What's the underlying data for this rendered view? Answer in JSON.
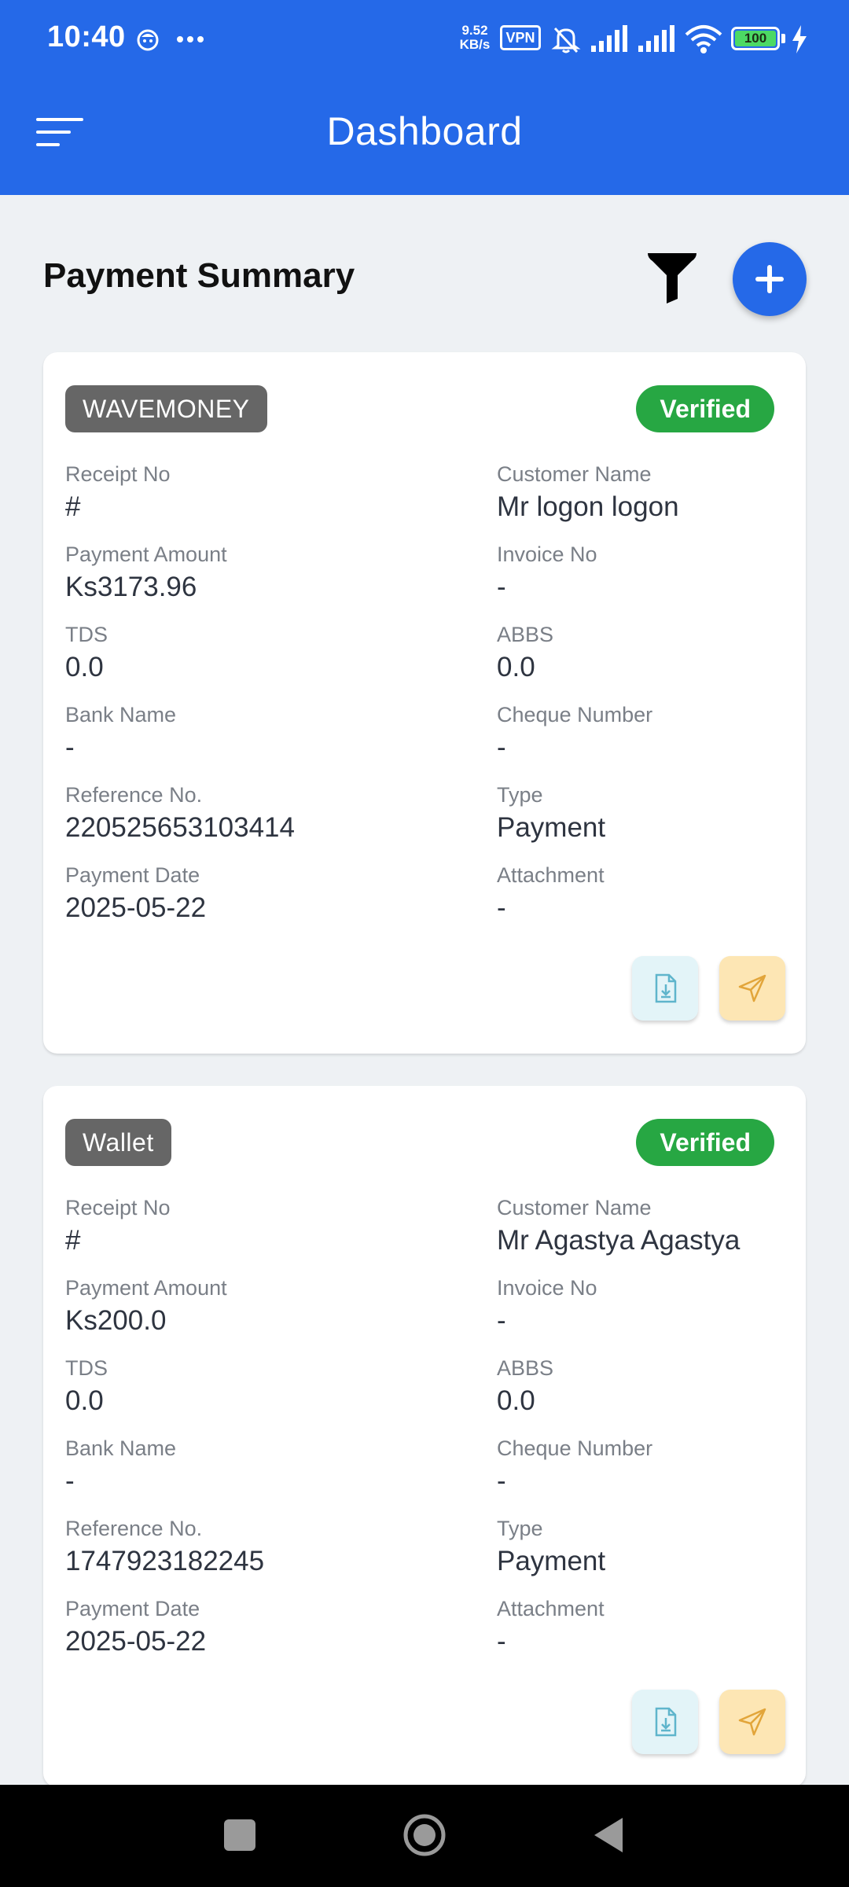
{
  "status_bar": {
    "time": "10:40",
    "net_speed_value": "9.52",
    "net_speed_unit": "KB/s",
    "vpn": "VPN",
    "battery": "100"
  },
  "app_bar": {
    "title": "Dashboard"
  },
  "summary": {
    "title": "Payment Summary"
  },
  "colors": {
    "primary": "#2569e8",
    "verified": "#27a743",
    "method_badge": "#666666"
  },
  "payments": [
    {
      "method": "WAVEMONEY",
      "status": "Verified",
      "fields": {
        "receipt_no": {
          "label": "Receipt No",
          "value": "#"
        },
        "customer_name": {
          "label": "Customer Name",
          "value": "Mr logon logon"
        },
        "payment_amount": {
          "label": "Payment Amount",
          "value": "Ks3173.96"
        },
        "invoice_no": {
          "label": "Invoice No",
          "value": "-"
        },
        "tds": {
          "label": "TDS",
          "value": "0.0"
        },
        "abbs": {
          "label": "ABBS",
          "value": "0.0"
        },
        "bank_name": {
          "label": "Bank Name",
          "value": "-"
        },
        "cheque_number": {
          "label": "Cheque Number",
          "value": "-"
        },
        "reference_no": {
          "label": "Reference No.",
          "value": "220525653103414"
        },
        "type": {
          "label": "Type",
          "value": "Payment"
        },
        "payment_date": {
          "label": "Payment Date",
          "value": "2025-05-22"
        },
        "attachment": {
          "label": "Attachment",
          "value": "-"
        }
      }
    },
    {
      "method": "Wallet",
      "status": "Verified",
      "fields": {
        "receipt_no": {
          "label": "Receipt No",
          "value": "#"
        },
        "customer_name": {
          "label": "Customer Name",
          "value": "Mr Agastya Agastya"
        },
        "payment_amount": {
          "label": "Payment Amount",
          "value": "Ks200.0"
        },
        "invoice_no": {
          "label": "Invoice No",
          "value": "-"
        },
        "tds": {
          "label": "TDS",
          "value": "0.0"
        },
        "abbs": {
          "label": "ABBS",
          "value": "0.0"
        },
        "bank_name": {
          "label": "Bank Name",
          "value": "-"
        },
        "cheque_number": {
          "label": "Cheque Number",
          "value": "-"
        },
        "reference_no": {
          "label": "Reference No.",
          "value": "1747923182245"
        },
        "type": {
          "label": "Type",
          "value": "Payment"
        },
        "payment_date": {
          "label": "Payment Date",
          "value": "2025-05-22"
        },
        "attachment": {
          "label": "Attachment",
          "value": "-"
        }
      }
    }
  ],
  "icons": {
    "status": [
      "face-icon",
      "more-dots-icon",
      "vpn-icon",
      "bell-muted-icon",
      "signal-icon",
      "wifi-icon",
      "battery-icon",
      "charging-icon"
    ],
    "app": [
      "menu-icon",
      "filter-icon",
      "plus-icon",
      "download-file-icon",
      "send-icon"
    ],
    "nav": [
      "recents-square-icon",
      "home-circle-icon",
      "back-triangle-icon"
    ]
  }
}
